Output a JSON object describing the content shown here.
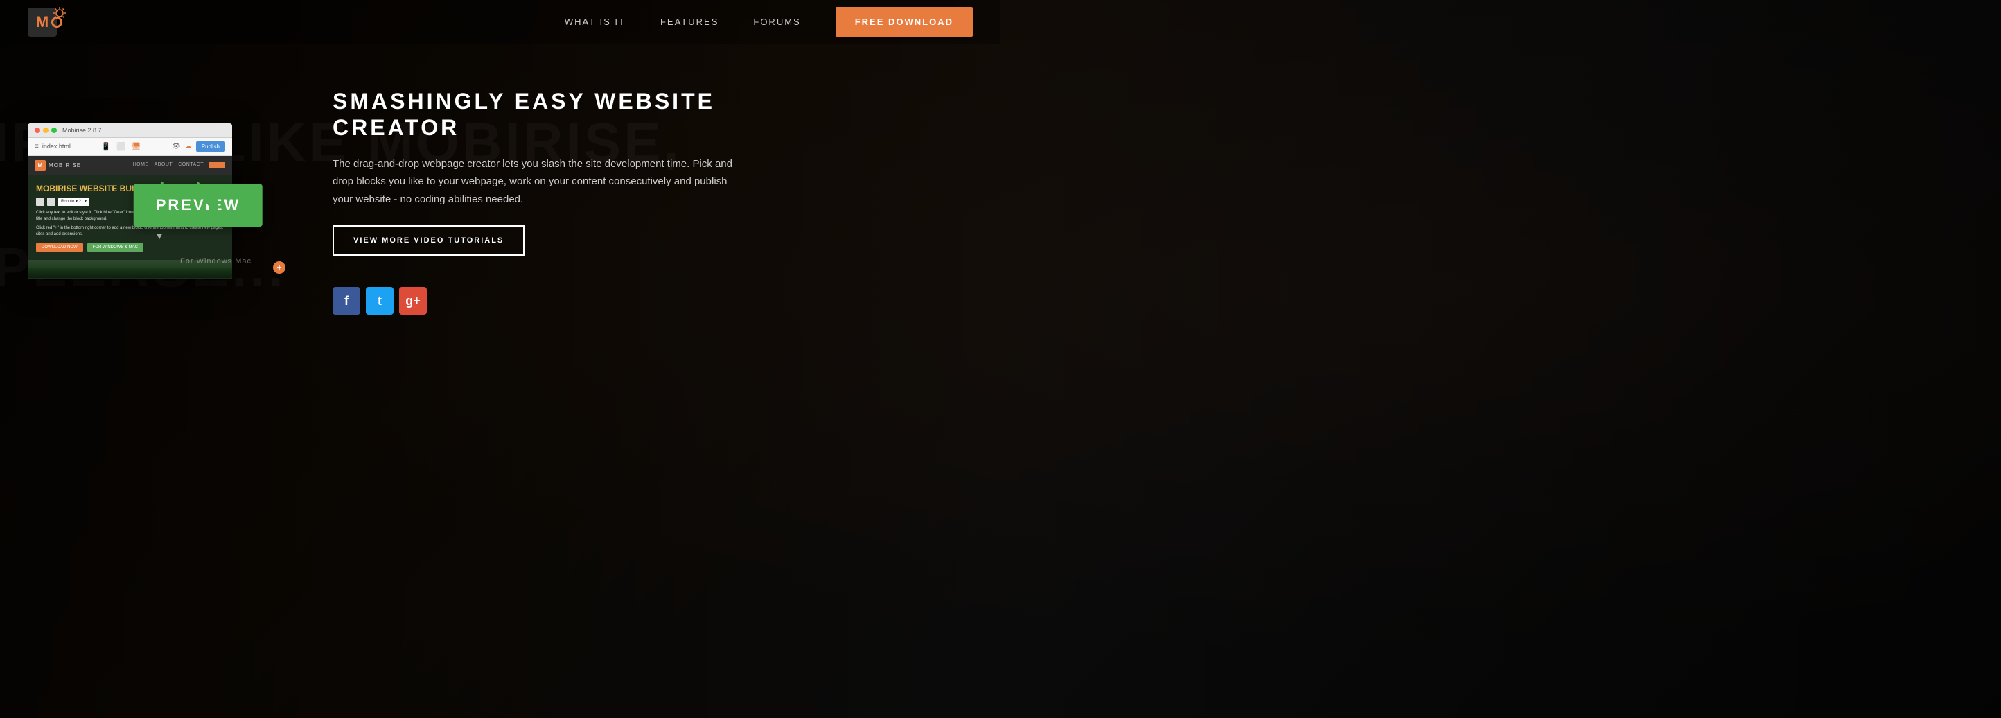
{
  "nav": {
    "logo_letter": "M",
    "links": [
      {
        "label": "WHAT IS IT",
        "id": "what-is-it"
      },
      {
        "label": "FEATURES",
        "id": "features"
      },
      {
        "label": "FORUMS",
        "id": "forums"
      }
    ],
    "cta_label": "FREE DOWNLOAD"
  },
  "app_window": {
    "title": "Mobirise 2.8.7",
    "file": "index.html",
    "brand": "MOBIRISE",
    "mobile_view_label": "Mobile View",
    "nav_items": [
      "HOME",
      "ABOUT",
      "CONTACT"
    ],
    "publish_label": "Publish",
    "hero_title": "MOBIRISE WEBSITE BUILD",
    "hero_text_1": "Click any text to edit or style it. Click blue \"Gear\" icon in the top right corner to hide/show buttons, text, title and change the block background.",
    "hero_text_2": "Click red \"+\" in the bottom right corner to add a new block. Use the top left menu to create new pages, sites and add extensions.",
    "btn_download": "DOWNLOAD NOW",
    "btn_windows": "FOR WINDOWS & MAC"
  },
  "preview": {
    "label": "PREVIEW"
  },
  "main": {
    "title_line1": "SMASHINGLY EASY WEBSITE",
    "title_line2": "CREATOR",
    "description": "The drag-and-drop webpage creator lets you slash the site development time. Pick and drop blocks you like to your webpage, work on your content consecutively and publish your website - no coding abilities needed.",
    "video_btn_label": "VIEW MORE VIDEO TUTORIALS",
    "bg_text_1": "IF YOU LIKE MOBIRISE,",
    "bg_text_2": "PLEASE..."
  },
  "social": {
    "facebook": "f",
    "twitter": "t",
    "googleplus": "g+"
  },
  "platform": {
    "text": "For Windows Mac"
  }
}
